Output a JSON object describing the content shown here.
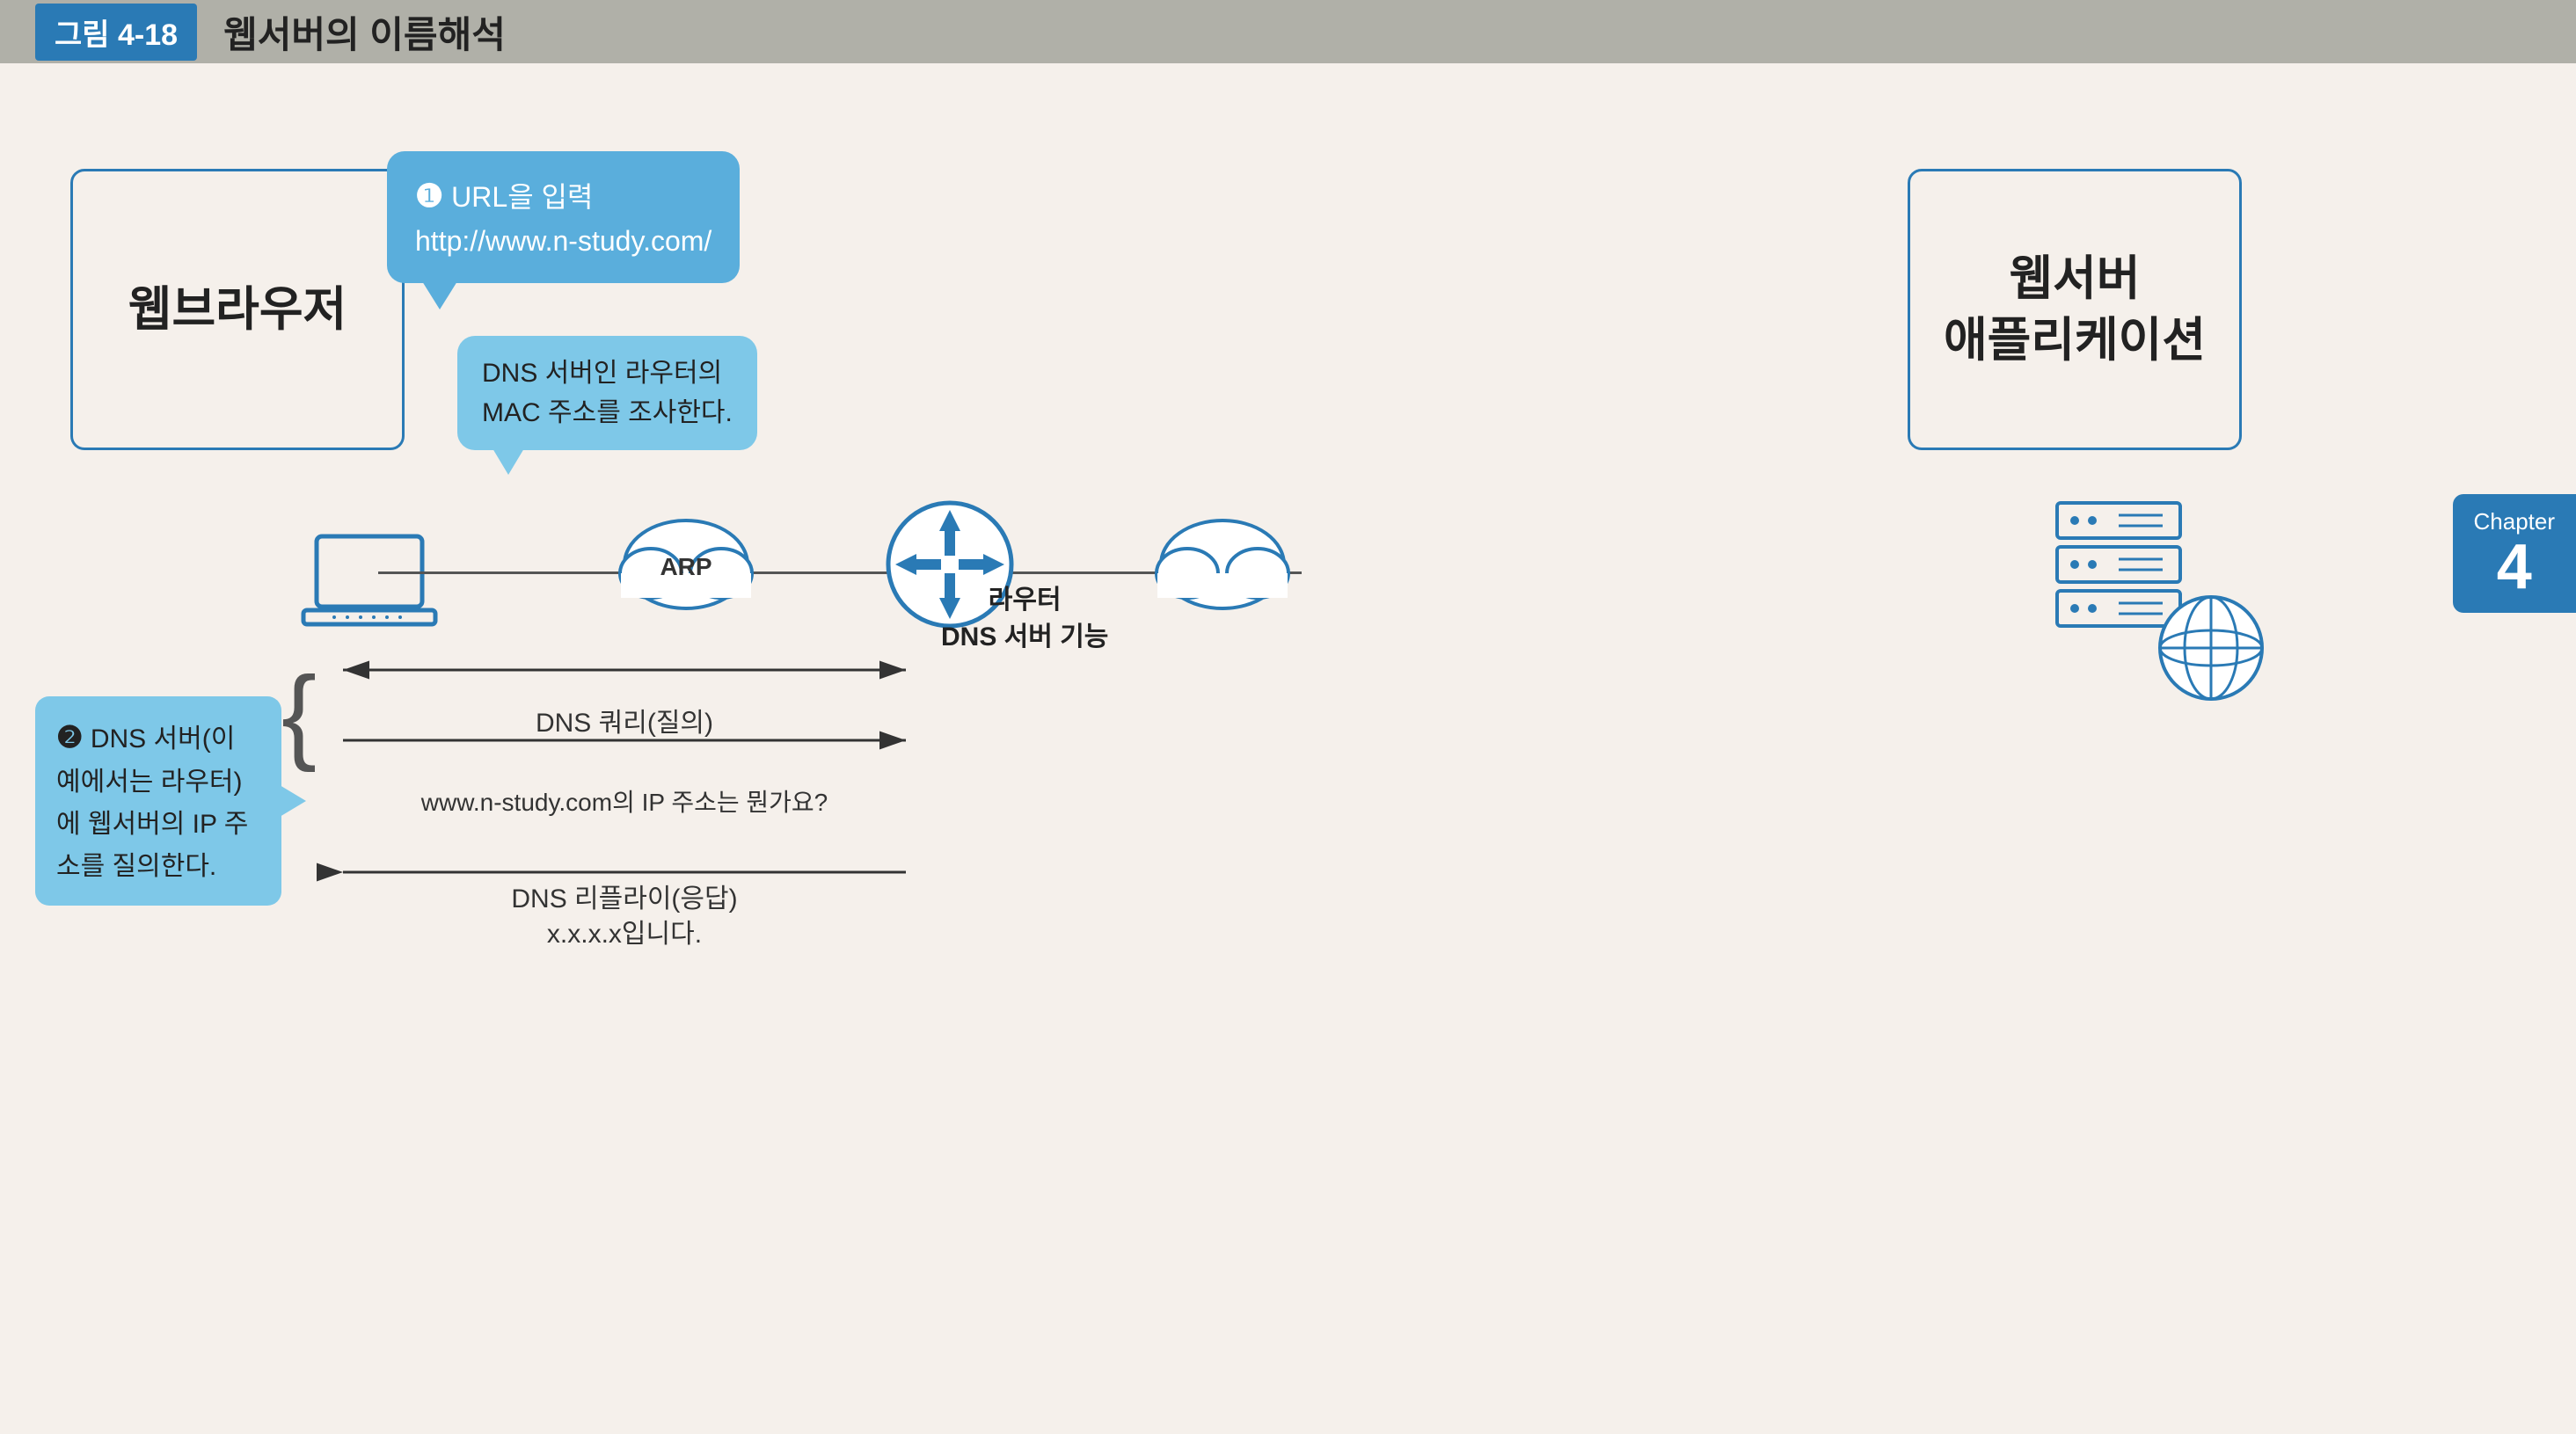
{
  "header": {
    "tag": "그림 4-18",
    "title": "웹서버의 이름해석"
  },
  "web_browser": {
    "label": "웹브라우저"
  },
  "web_server": {
    "line1": "웹서버",
    "line2": "애플리케이션"
  },
  "bubble_url": {
    "step": "❶",
    "line1": "URL을 입력",
    "line2": "http://www.n-study.com/"
  },
  "bubble_dns_mac": {
    "line1": "DNS 서버인 라우터의",
    "line2": "MAC 주소를 조사한다."
  },
  "arp_label": "ARP",
  "router_label": {
    "line1": "라우터",
    "line2": "DNS 서버 기능"
  },
  "dns_server_box": {
    "step": "❷",
    "text": " DNS 서버(이 예에서는 라우터)에 웹서버의 IP 주소를 질의한다."
  },
  "arrows": {
    "row1_right_label": "",
    "row2_label": "DNS 쿼리(질의)",
    "row3_label": "www.n-study.com의 IP 주소는 뭔가요?",
    "row4_label": "DNS 리플라이(응답)",
    "row4_sub": "x.x.x.x입니다."
  },
  "chapter": {
    "word": "Chapter",
    "number": "4"
  }
}
